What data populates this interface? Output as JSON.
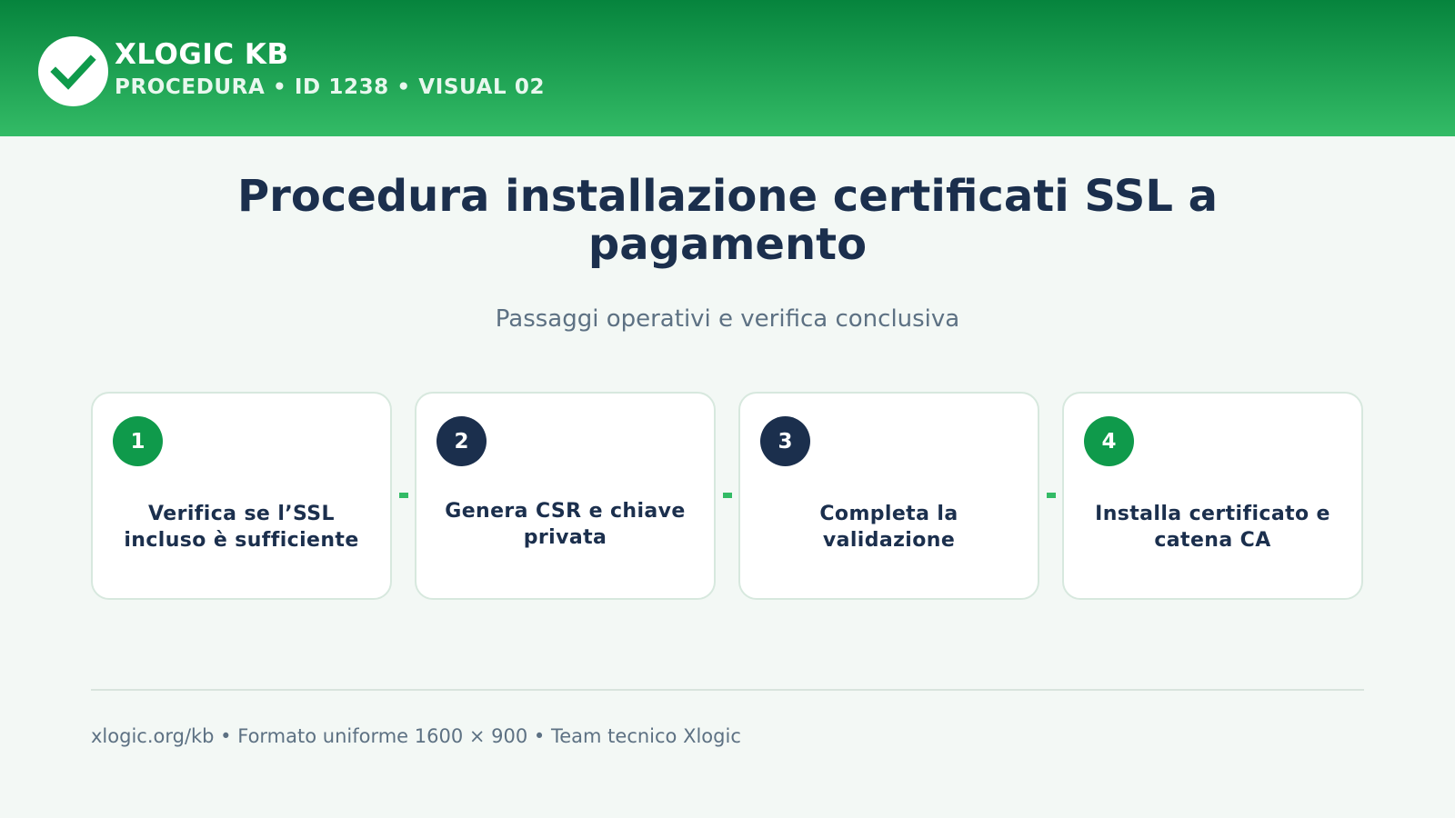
{
  "header": {
    "brand": "XLOGIC KB",
    "meta": "PROCEDURA • ID 1238 • VISUAL 02",
    "logo_icon": "check-icon"
  },
  "main": {
    "title": "Procedura installazione certificati SSL a pagamento",
    "subtitle": "Passaggi operativi e verifica conclusiva"
  },
  "steps": [
    {
      "number": "1",
      "text": "Verifica se l’SSL incluso è sufficiente",
      "badge_color": "#0f9a4b"
    },
    {
      "number": "2",
      "text": "Genera CSR e chiave privata",
      "badge_color": "#1b2f4d"
    },
    {
      "number": "3",
      "text": "Completa la validazione",
      "badge_color": "#1b2f4d"
    },
    {
      "number": "4",
      "text": "Installa certificato e catena CA",
      "badge_color": "#0f9a4b"
    }
  ],
  "footer": {
    "text": "xlogic.org/kb • Formato uniforme 1600 × 900 • Team tecnico Xlogic"
  },
  "colors": {
    "brand_green": "#0f9a4b",
    "header_gradient_top": "#06843d",
    "header_gradient_bottom": "#33bb66",
    "navy": "#1b2f4d",
    "muted_text": "#5d7183",
    "page_background": "#f3f8f5"
  }
}
